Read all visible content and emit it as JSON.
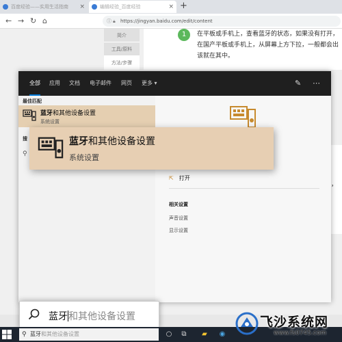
{
  "browser": {
    "tabs": [
      {
        "label": "百度经验——实用生活指南"
      },
      {
        "label": "编辑经验_百度经验"
      }
    ],
    "new_tab_symbol": "+",
    "url": "https://jingyan.baidu.com/edit/content"
  },
  "webpage": {
    "left_nav": [
      "简介",
      "工具/原料",
      "方法/步骤"
    ],
    "step_number": "1",
    "step_text": "在平板或手机上，查看蓝牙的状态，如果没有打开，在国产平板或手机上，从屏幕上方下拉，一般都会出该就在其中。",
    "right_fragment_1": "\"蓝",
    "right_fragment_2": "去，"
  },
  "search_panel": {
    "tabs": [
      "全部",
      "应用",
      "文档",
      "电子邮件",
      "网页",
      "更多 ▾"
    ],
    "best_match_label": "最佳匹配",
    "best_match": {
      "title_bold": "蓝牙",
      "title_rest": "和其他设备设置",
      "subtitle": "系统设置"
    },
    "search_web_label": "搜",
    "right": {
      "open_label": "打开",
      "related_label": "相关设置",
      "related_links": [
        "声音设置",
        "显示设置"
      ]
    }
  },
  "zoom_card": {
    "title_bold": "蓝牙",
    "title_rest": "和其他设备设置",
    "subtitle": "系统设置"
  },
  "zoom_search": {
    "typed": "蓝牙",
    "suggestion": "和其他设备设置"
  },
  "taskbar": {
    "search_typed": "蓝牙",
    "search_suggestion": "和其他设备设置"
  },
  "watermark": {
    "title": "飞沙系统网",
    "url": "www.fs0745.com"
  },
  "colors": {
    "accent": "#0078d7",
    "highlight": "#e5cfb1",
    "header_dark": "#1f1f1f",
    "taskbar": "#1d2530",
    "step_green": "#5cb85c"
  }
}
